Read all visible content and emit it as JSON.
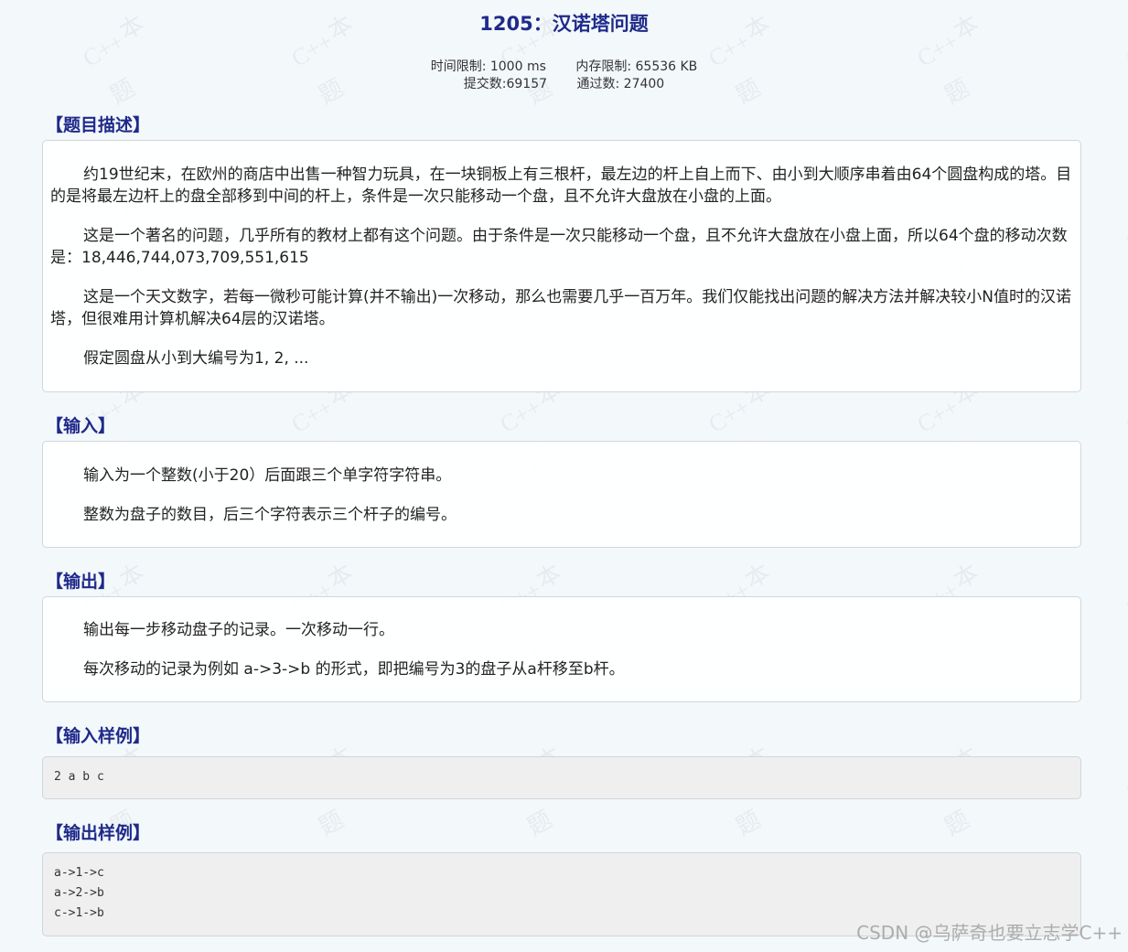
{
  "problem": {
    "title": "1205：汉诺塔问题",
    "time_limit": "时间限制: 1000 ms",
    "memory_limit": "内存限制: 65536 KB",
    "submissions": "提交数:69157",
    "accepted": "通过数: 27400"
  },
  "sections": {
    "description_title": "【题目描述】",
    "description": [
      "约19世纪末，在欧州的商店中出售一种智力玩具，在一块铜板上有三根杆，最左边的杆上自上而下、由小到大顺序串着由64个圆盘构成的塔。目的是将最左边杆上的盘全部移到中间的杆上，条件是一次只能移动一个盘，且不允许大盘放在小盘的上面。",
      "这是一个著名的问题，几乎所有的教材上都有这个问题。由于条件是一次只能移动一个盘，且不允许大盘放在小盘上面，所以64个盘的移动次数是：18,446,744,073,709,551,615",
      "这是一个天文数字，若每一微秒可能计算(并不输出)一次移动，那么也需要几乎一百万年。我们仅能找出问题的解决方法并解决较小N值时的汉诺塔，但很难用计算机解决64层的汉诺塔。",
      "假定圆盘从小到大编号为1, 2, ..."
    ],
    "input_title": "【输入】",
    "input": [
      "输入为一个整数(小于20）后面跟三个单字符字符串。",
      "整数为盘子的数目，后三个字符表示三个杆子的编号。"
    ],
    "output_title": "【输出】",
    "output": [
      "输出每一步移动盘子的记录。一次移动一行。",
      "每次移动的记录为例如 a->3->b 的形式，即把编号为3的盘子从a杆移至b杆。"
    ],
    "sample_input_title": "【输入样例】",
    "sample_input": [
      "2 a b c"
    ],
    "sample_output_title": "【输出样例】",
    "sample_output": [
      "a->1->c",
      "a->2->b",
      "c->1->b"
    ]
  },
  "watermark": {
    "text": "C++",
    "char1": "本",
    "char2": "题"
  },
  "footer": {
    "credit": "CSDN @乌萨奇也要立志学C++"
  }
}
